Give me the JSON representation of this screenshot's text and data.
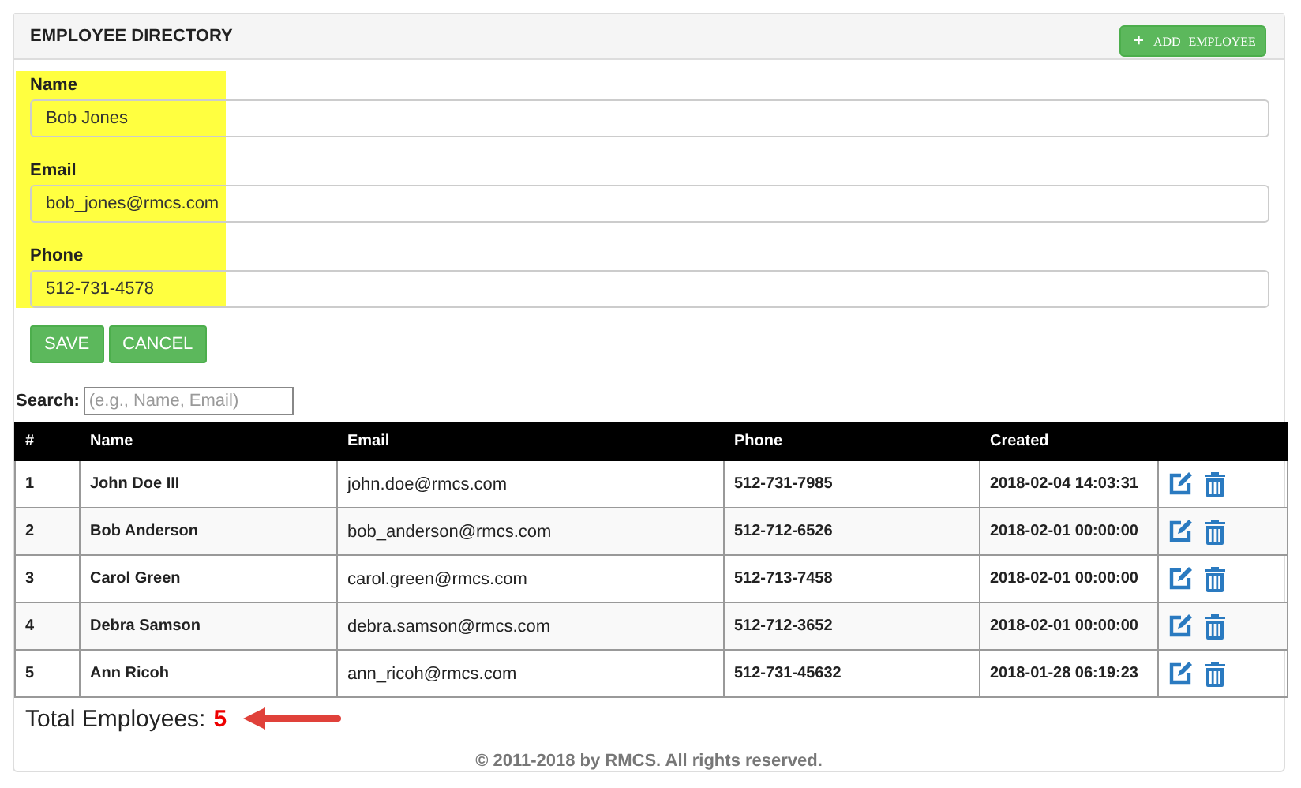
{
  "panel": {
    "title": "EMPLOYEE DIRECTORY",
    "add_button": {
      "icon": "+",
      "label": "ADD EMPLOYEE"
    }
  },
  "form": {
    "fields": [
      {
        "label": "Name",
        "value": "Bob Jones"
      },
      {
        "label": "Email",
        "value": "bob_jones@rmcs.com"
      },
      {
        "label": "Phone",
        "value": "512-731-4578"
      }
    ],
    "buttons": [
      "SAVE",
      "CANCEL"
    ]
  },
  "search": {
    "label": "Search:",
    "placeholder": "(e.g., Name, Email)"
  },
  "table": {
    "columns": [
      "#",
      "Name",
      "Email",
      "Phone",
      "Created"
    ],
    "rows": [
      [
        "1",
        "John Doe III",
        "john.doe@rmcs.com",
        "512-731-7985",
        "2018-02-04 14:03:31"
      ],
      [
        "2",
        "Bob Anderson",
        "bob_anderson@rmcs.com",
        "512-712-6526",
        "2018-02-01 00:00:00"
      ],
      [
        "3",
        "Carol Green",
        "carol.green@rmcs.com",
        "512-713-7458",
        "2018-02-01 00:00:00"
      ],
      [
        "4",
        "Debra Samson",
        "debra.samson@rmcs.com",
        "512-712-3652",
        "2018-02-01 00:00:00"
      ],
      [
        "5",
        "Ann Ricoh",
        "ann_ricoh@rmcs.com",
        "512-731-45632",
        "2018-01-28 06:19:23"
      ]
    ]
  },
  "total": {
    "label": "Total Employees:",
    "count": "5"
  },
  "footer": "© 2011-2018 by RMCS. All rights reserved."
}
